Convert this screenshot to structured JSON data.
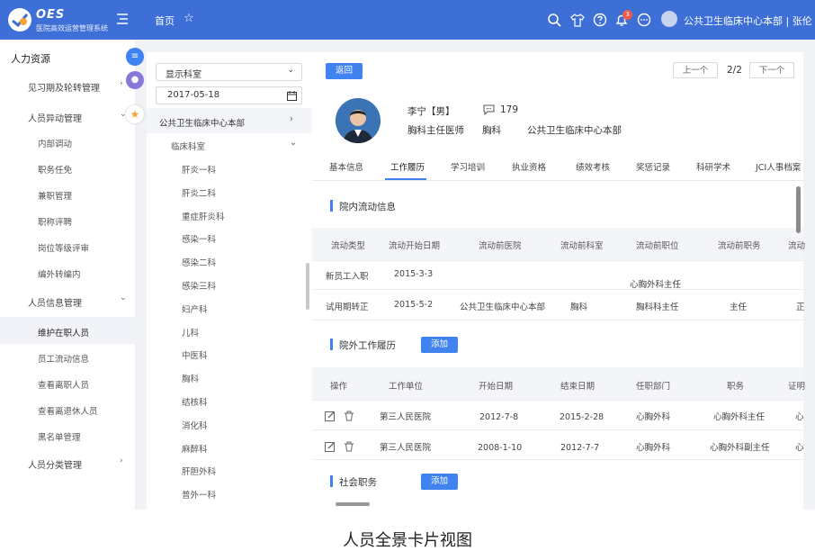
{
  "header": {
    "brand": "OES",
    "brand_sub": "医院高效运营管理系统",
    "home": "首页",
    "badge": "3",
    "user": "公共卫生临床中心本部 | 张伦"
  },
  "sidebar": {
    "title": "人力资源",
    "items": [
      {
        "label": "见习期及轮转管理",
        "level": 1
      },
      {
        "label": "人员异动管理",
        "level": 1
      },
      {
        "label": "内部调动",
        "level": 2
      },
      {
        "label": "职务任免",
        "level": 2
      },
      {
        "label": "兼职管理",
        "level": 2
      },
      {
        "label": "职称评聘",
        "level": 2
      },
      {
        "label": "岗位等级评审",
        "level": 2
      },
      {
        "label": "编外转编内",
        "level": 2
      },
      {
        "label": "人员信息管理",
        "level": 1
      },
      {
        "label": "维护在职人员",
        "level": 2,
        "active": true
      },
      {
        "label": "员工流动信息",
        "level": 2
      },
      {
        "label": "查看离职人员",
        "level": 2
      },
      {
        "label": "查看离退休人员",
        "level": 2
      },
      {
        "label": "黑名单管理",
        "level": 2
      },
      {
        "label": "人员分类管理",
        "level": 1
      }
    ]
  },
  "tree": {
    "select": "显示科室",
    "date": "2017-05-18",
    "org": "公共卫生临床中心本部",
    "dept_group": "临床科室",
    "depts": [
      "肝炎一科",
      "肝炎二科",
      "重症肝炎科",
      "感染一科",
      "感染二科",
      "感染三科",
      "妇产科",
      "儿科",
      "中医科",
      "胸科",
      "结核科",
      "消化科",
      "麻醉科",
      "肝胆外科",
      "普外一科"
    ]
  },
  "profile": {
    "back": "返回",
    "prev": "上一个",
    "page": "2/2",
    "next": "下一个",
    "name": "李宁【男】",
    "count": "179",
    "title": "胸科主任医师",
    "dept": "胸科",
    "org": "公共卫生临床中心本部"
  },
  "tabs": [
    "基本信息",
    "工作履历",
    "学习培训",
    "执业资格",
    "绩效考核",
    "奖惩记录",
    "科研学术",
    "JCI人事档案"
  ],
  "internal": {
    "title": "院内流动信息",
    "headers": [
      "流动类型",
      "流动开始日期",
      "流动前医院",
      "流动前科室",
      "流动前职位",
      "流动前职务",
      "流动"
    ],
    "rows": [
      [
        "新员工入职",
        "2015-3-3",
        "",
        "",
        "心胸外科主任",
        "",
        ""
      ],
      [
        "试用期转正",
        "2015-5-2",
        "公共卫生临床中心本部",
        "胸科",
        "胸科科主任",
        "主任",
        "正"
      ]
    ]
  },
  "external": {
    "title": "院外工作履历",
    "add": "添加",
    "headers": [
      "操作",
      "工作单位",
      "开始日期",
      "结束日期",
      "任职部门",
      "职务",
      "证明"
    ],
    "rows": [
      [
        "",
        "第三人民医院",
        "2012-7-8",
        "2015-2-28",
        "心胸外科",
        "心胸外科主任",
        "心"
      ],
      [
        "",
        "第三人民医院",
        "2008-1-10",
        "2012-7-7",
        "心胸外科",
        "心胸外科副主任",
        "心"
      ]
    ]
  },
  "social": {
    "title": "社会职务",
    "add": "添加"
  },
  "caption": "人员全景卡片视图",
  "colors": {
    "primary": "#3d6fd6",
    "accent": "#3f82f0"
  }
}
